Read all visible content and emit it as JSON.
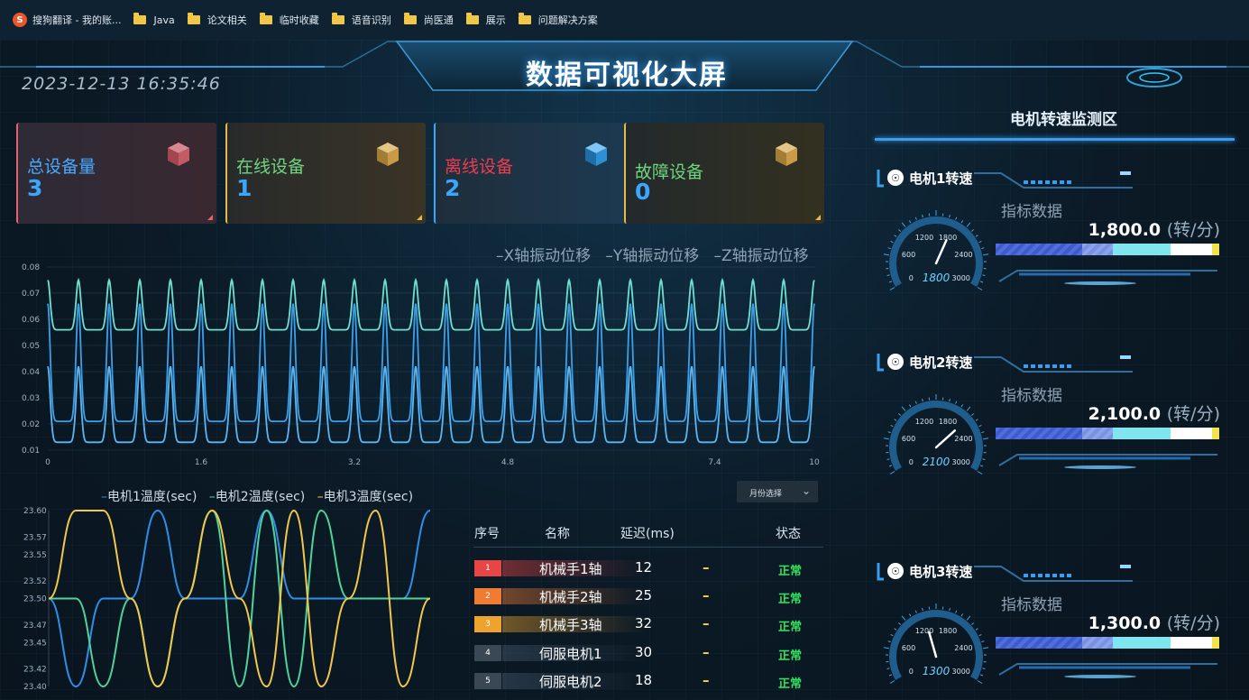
{
  "bookmarks": {
    "items": [
      {
        "label": "搜狗翻译 - 我的账...",
        "icon": "sogou-icon"
      },
      {
        "label": "Java",
        "icon": "folder-icon"
      },
      {
        "label": "论文相关",
        "icon": "folder-icon"
      },
      {
        "label": "临时收藏",
        "icon": "folder-icon"
      },
      {
        "label": "语音识别",
        "icon": "folder-icon"
      },
      {
        "label": "尚医通",
        "icon": "folder-icon"
      },
      {
        "label": "展示",
        "icon": "folder-icon"
      },
      {
        "label": "问题解决方案",
        "icon": "folder-icon"
      }
    ]
  },
  "header": {
    "datetime": "2023-12-13 16:35:46",
    "title": "数据可视化大屏"
  },
  "stats": [
    {
      "label": "总设备量",
      "value": "3",
      "label_color": "#4aa9ff",
      "accent": "#e0636e"
    },
    {
      "label": "在线设备",
      "value": "1",
      "label_color": "#6fd57e",
      "accent": "#e8b94a"
    },
    {
      "label": "离线设备",
      "value": "2",
      "label_color": "#ee3d4f",
      "accent": "#3aa7ff"
    },
    {
      "label": "故障设备",
      "value": "0",
      "label_color": "#6fd57e",
      "accent": "#e8b94a"
    }
  ],
  "vibration": {
    "legend": [
      "X轴振动位移",
      "Y轴振动位移",
      "Z轴振动位移"
    ],
    "colors": [
      "#6fe0cf",
      "#3aa0ee",
      "#5cb6f0"
    ]
  },
  "temperature": {
    "legend": [
      "电机1温度(sec)",
      "电机2温度(sec)",
      "电机3温度(sec)"
    ],
    "colors": [
      "#2f8fe8",
      "#4fd39a",
      "#f2c84b"
    ]
  },
  "chart_data": [
    {
      "type": "line",
      "title": "",
      "xlabel": "",
      "ylabel": "",
      "x_ticks": [
        "0",
        "1.6",
        "3.2",
        "4.8",
        "7.4",
        "10"
      ],
      "y_ticks": [
        "0.01",
        "0.02",
        "0.03",
        "0.04",
        "0.05",
        "0.06",
        "0.07",
        "0.08"
      ],
      "ylim": [
        0.01,
        0.08
      ],
      "xlim": [
        0,
        10
      ],
      "grid": true,
      "legend_position": "top-right",
      "series": [
        {
          "name": "X轴振动位移",
          "baseline": 0.056,
          "peak": 0.075,
          "peaks": 25
        },
        {
          "name": "Y轴振动位移",
          "baseline": 0.021,
          "peak": 0.066,
          "peaks": 25
        },
        {
          "name": "Z轴振动位移",
          "baseline": 0.013,
          "peak": 0.042,
          "peaks": 25
        }
      ]
    },
    {
      "type": "line",
      "title": "",
      "xlabel": "",
      "ylabel": "",
      "y_ticks": [
        "23.60",
        "23.57",
        "23.55",
        "23.52",
        "23.50",
        "23.47",
        "23.45",
        "23.42",
        "23.40"
      ],
      "ylim": [
        23.4,
        23.6
      ],
      "legend_position": "top",
      "series": [
        {
          "name": "电机1温度(sec)",
          "values": [
            23.5,
            23.4,
            23.5,
            23.5,
            23.6,
            23.5,
            23.5,
            23.5,
            23.6,
            23.5,
            23.5,
            23.5,
            23.5,
            23.5,
            23.6
          ]
        },
        {
          "name": "电机2温度(sec)",
          "values": [
            23.5,
            23.5,
            23.4,
            23.5,
            23.4,
            23.5,
            23.6,
            23.4,
            23.6,
            23.4,
            23.6,
            23.5,
            23.5,
            23.5,
            23.5
          ]
        },
        {
          "name": "电机3温度(sec)",
          "values": [
            23.5,
            23.6,
            23.6,
            23.5,
            23.4,
            23.5,
            23.6,
            23.5,
            23.4,
            23.6,
            23.4,
            23.5,
            23.6,
            23.4,
            23.5
          ]
        }
      ]
    }
  ],
  "dropdown": {
    "label": "月份选择"
  },
  "table": {
    "headers": [
      "序号",
      "名称",
      "延迟(ms)",
      "状态"
    ],
    "rows": [
      {
        "rank": "1",
        "name": "机械手1轴",
        "delay": "12",
        "trend": "–",
        "status": "正常",
        "rank_color": "#e84545"
      },
      {
        "rank": "2",
        "name": "机械手2轴",
        "delay": "25",
        "trend": "–",
        "status": "正常",
        "rank_color": "#f07c33"
      },
      {
        "rank": "3",
        "name": "机械手3轴",
        "delay": "32",
        "trend": "–",
        "status": "正常",
        "rank_color": "#eda32c"
      },
      {
        "rank": "4",
        "name": "伺服电机1",
        "delay": "30",
        "trend": "–",
        "status": "正常",
        "rank_color": "#3a4856"
      },
      {
        "rank": "5",
        "name": "伺服电机2",
        "delay": "18",
        "trend": "–",
        "status": "正常",
        "rank_color": "#3a4856"
      }
    ]
  },
  "monitor": {
    "title": "电机转速监测区",
    "motors": [
      {
        "name": "电机1转速",
        "indicator_label": "指标数据",
        "value": "1,800.0",
        "unit": "(转/分)",
        "gauge_value": "1800",
        "rpm": 1800,
        "gauge_ticks": [
          "0",
          "600",
          "1200",
          "1800",
          "2400",
          "3000"
        ]
      },
      {
        "name": "电机2转速",
        "indicator_label": "指标数据",
        "value": "2,100.0",
        "unit": "(转/分)",
        "gauge_value": "2100",
        "rpm": 2100,
        "gauge_ticks": [
          "0",
          "600",
          "1200",
          "1800",
          "2400",
          "3000"
        ]
      },
      {
        "name": "电机3转速",
        "indicator_label": "指标数据",
        "value": "1,300.0",
        "unit": "(转/分)",
        "gauge_value": "1300",
        "rpm": 1300,
        "gauge_ticks": [
          "0",
          "600",
          "1200",
          "1800",
          "2400",
          "3000"
        ]
      }
    ]
  }
}
